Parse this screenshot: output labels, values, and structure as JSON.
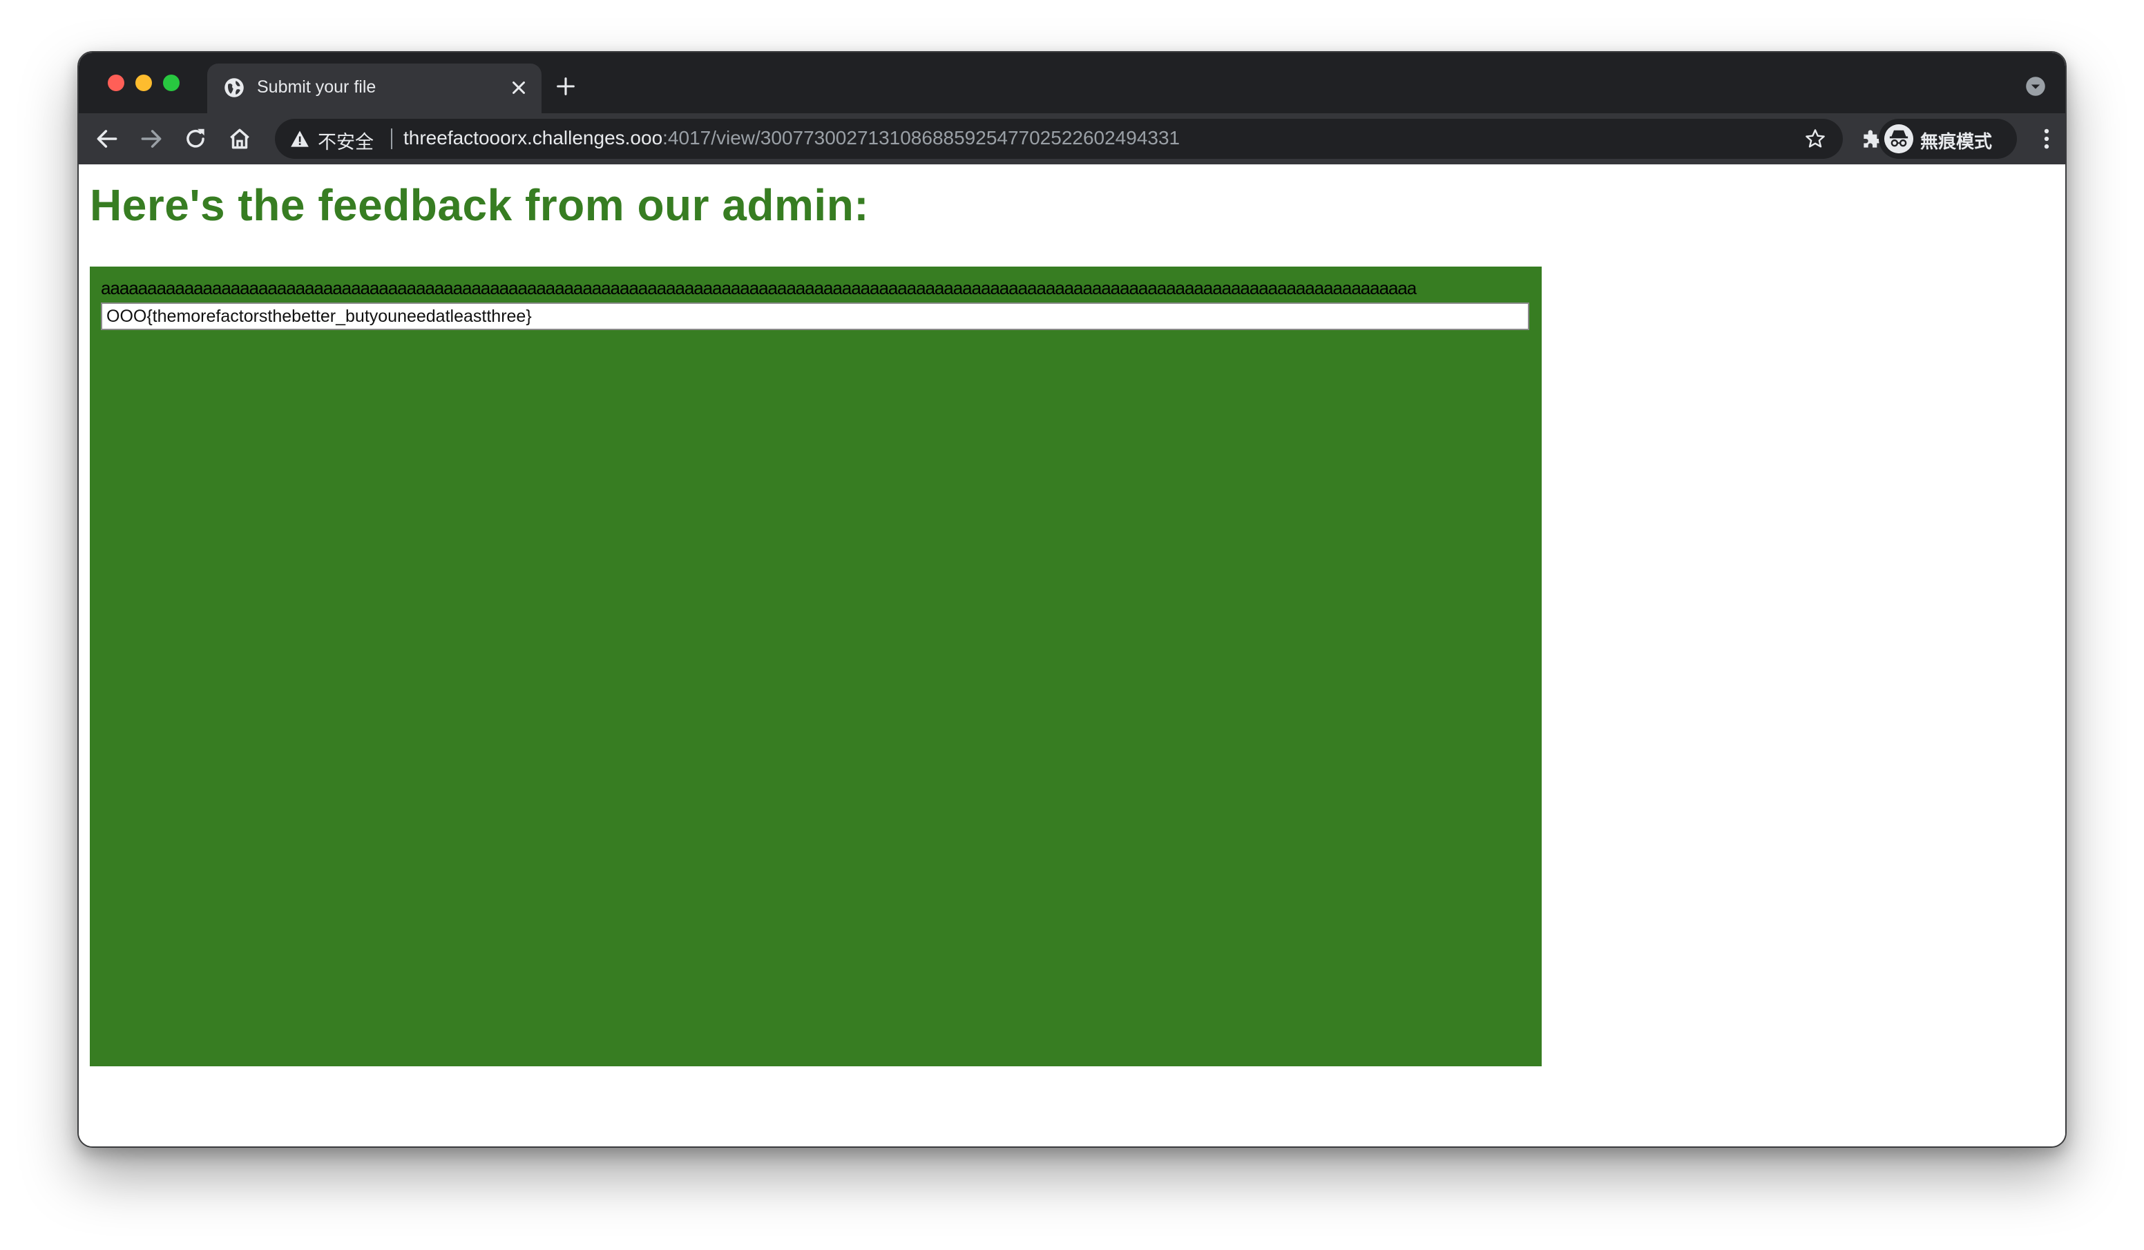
{
  "browser": {
    "tab_title": "Submit your file",
    "address_insecure_label": "不安全",
    "url_host": "threefactooorx.challenges.ooo",
    "url_rest": ":4017/view/300773002713108688592547702522602494331",
    "profile_label": "無痕模式"
  },
  "page": {
    "heading": "Here's the feedback from our admin:",
    "feedback_text": "aaaaaaaaaaaaaaaaaaaaaaaaaaaaaaaaaaaaaaaaaaaaaaaaaaaaaaaaaaaaaaaaaaaaaaaaaaaaaaaaaaaaaaaaaaaaaaaaaaaaaaaaaaaaaaaaaaaaaaaaaaaaaaaaaaaaaaaaaaaaaa",
    "flag_value": "OOO{themorefactorsthebetter_butyouneedatleastthree}"
  },
  "colors": {
    "accent_green": "#377d22",
    "chrome_dark": "#202124",
    "chrome_toolbar": "#35363a"
  },
  "icons": {
    "tab_favicon": "globe-icon",
    "tab_close": "close-icon",
    "new_tab": "plus-icon",
    "tab_search": "chevron-down-circle-icon",
    "back": "arrow-left-icon",
    "forward": "arrow-right-icon",
    "reload": "reload-icon",
    "home": "home-icon",
    "security": "warning-triangle-icon",
    "bookmark": "star-icon",
    "extensions": "puzzle-icon",
    "incognito": "incognito-icon",
    "menu": "kebab-menu-icon"
  }
}
